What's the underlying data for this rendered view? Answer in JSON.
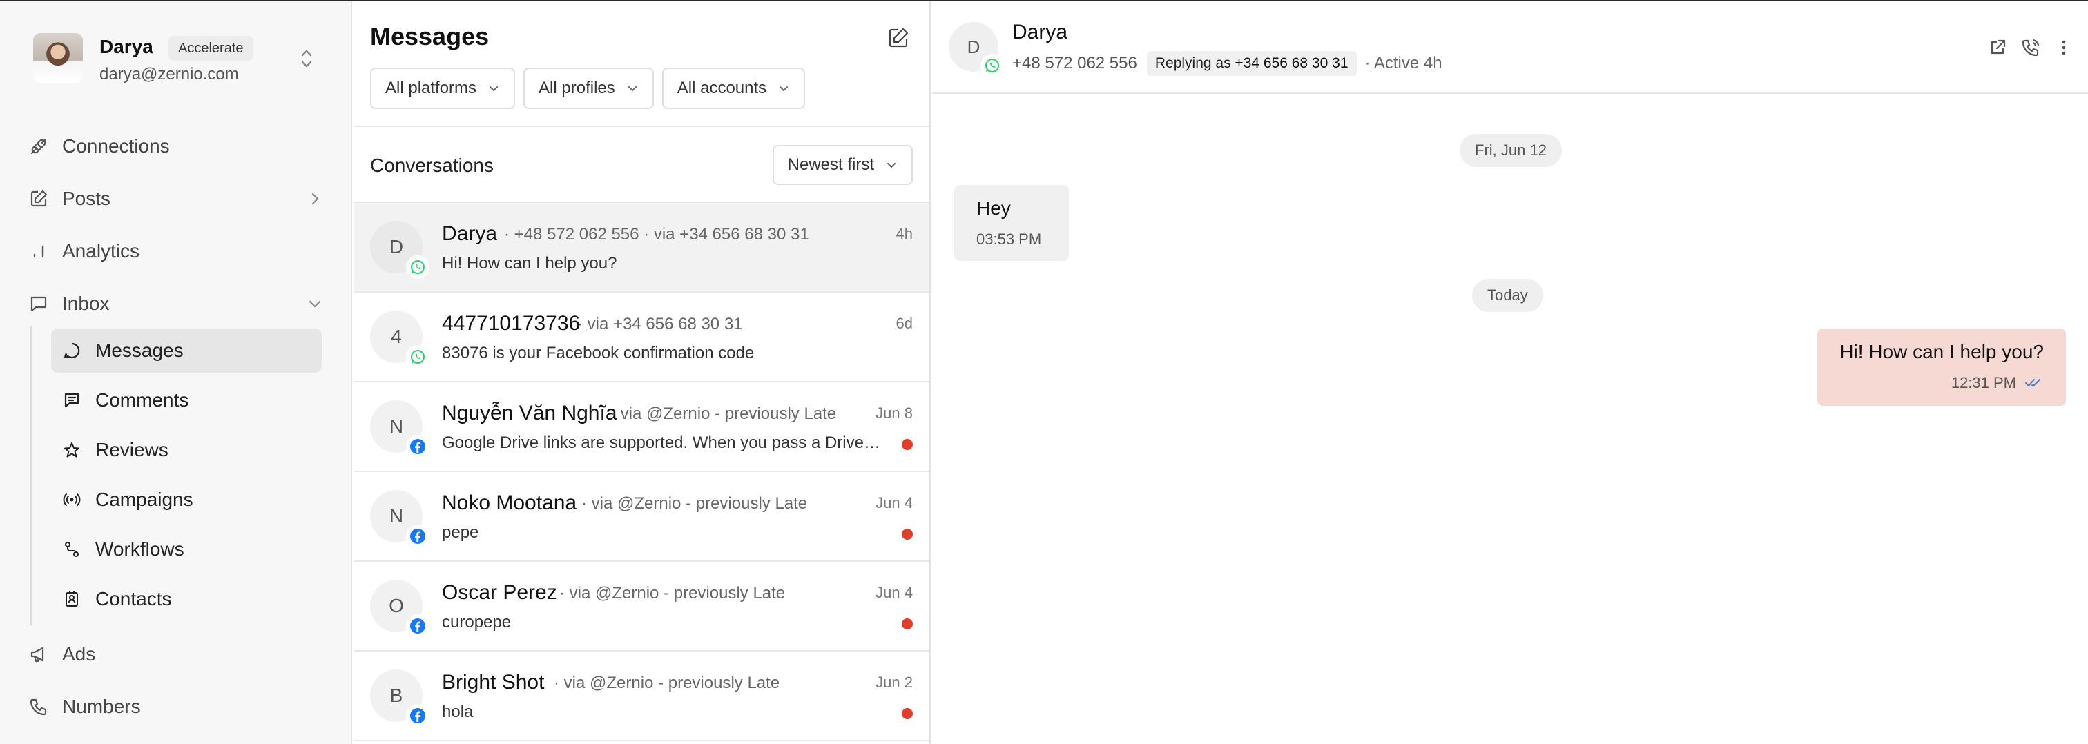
{
  "profile": {
    "name": "Darya",
    "plan": "Accelerate",
    "email": "darya@zernio.com"
  },
  "nav": {
    "connections": "Connections",
    "posts": "Posts",
    "analytics": "Analytics",
    "inbox": "Inbox",
    "ads": "Ads",
    "numbers": "Numbers",
    "inbox_sub": {
      "messages": "Messages",
      "comments": "Comments",
      "reviews": "Reviews",
      "campaigns": "Campaigns",
      "workflows": "Workflows",
      "contacts": "Contacts"
    }
  },
  "messages_panel": {
    "title": "Messages",
    "filters": [
      "All platforms",
      "All profiles",
      "All accounts"
    ],
    "conversations_label": "Conversations",
    "sort": "Newest first"
  },
  "conversations": [
    {
      "initial": "D",
      "name": "Darya",
      "meta": "· +48 572 062 556  · via +34 656 68 30 31",
      "time": "4h",
      "preview": "Hi! How can I help you?",
      "platform": "whatsapp",
      "unread": false
    },
    {
      "initial": "4",
      "name": "447710173736",
      "meta": "· via +34 656 68 30 31",
      "time": "6d",
      "preview": "83076 is your Facebook confirmation code",
      "platform": "whatsapp",
      "unread": false
    },
    {
      "initial": "N",
      "name": "Nguyễn Văn Nghĩa",
      "meta": "· via @Zernio - previously Late",
      "time": "Jun 8",
      "preview": "Google Drive links are supported. When you pass a Drive sharing link as a media URL, we automatically",
      "platform": "facebook",
      "unread": true
    },
    {
      "initial": "N",
      "name": "Noko Mootana",
      "meta": "· via @Zernio - previously Late",
      "time": "Jun 4",
      "preview": "pepe",
      "platform": "facebook",
      "unread": true
    },
    {
      "initial": "O",
      "name": "Oscar Perez",
      "meta": "· via @Zernio - previously Late",
      "time": "Jun 4",
      "preview": "curopepe",
      "platform": "facebook",
      "unread": true
    },
    {
      "initial": "B",
      "name": "Bright Shot",
      "meta": "· via @Zernio - previously Late",
      "time": "Jun 2",
      "preview": "hola",
      "platform": "facebook",
      "unread": true
    }
  ],
  "chat": {
    "initial": "D",
    "name": "Darya",
    "phone": "+48 572 062 556",
    "replying_prefix": "Replying as",
    "replying_number": "+34 656 68 30 31",
    "active": "· Active 4h",
    "date1": "Fri, Jun 12",
    "date2": "Today",
    "incoming": {
      "text": "Hey",
      "time": "03:53 PM"
    },
    "outgoing": {
      "text": "Hi! How can I help you?",
      "time": "12:31 PM"
    }
  },
  "colors": {
    "whatsapp": "#25D366",
    "facebook": "#1877F2",
    "unread_dot": "#E03E2A",
    "outgoing_bubble": "#F7D9D4",
    "read_check": "#4A7BD0"
  }
}
